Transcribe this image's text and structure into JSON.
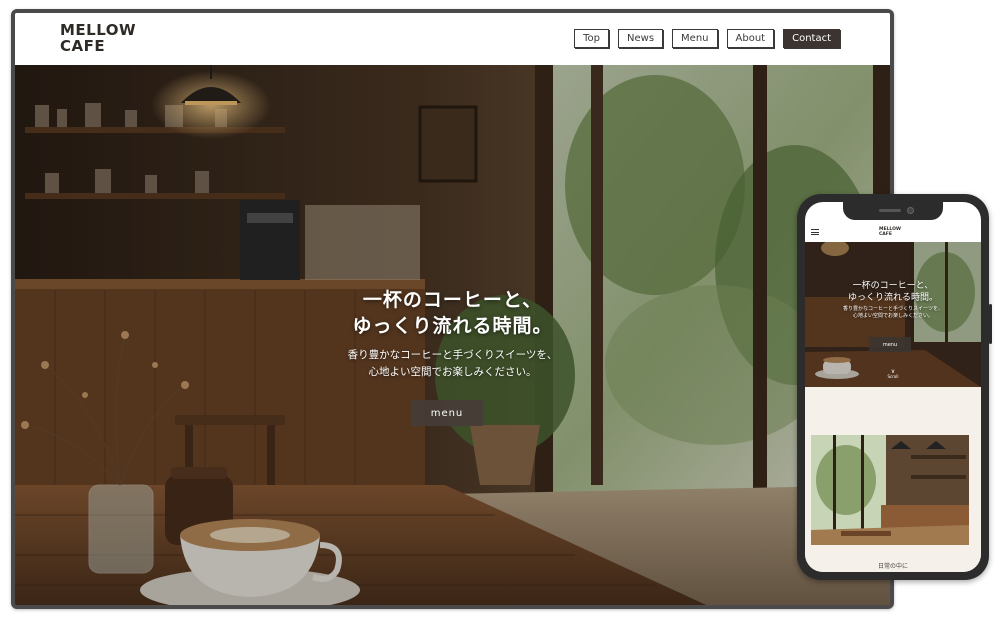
{
  "desktop": {
    "logo": {
      "line1": "MELLOW",
      "line2": "CAFE"
    },
    "nav": [
      {
        "label": "Top"
      },
      {
        "label": "News"
      },
      {
        "label": "Menu"
      },
      {
        "label": "About"
      },
      {
        "label": "Contact"
      }
    ],
    "hero": {
      "title_line1": "一杯のコーヒーと、",
      "title_line2": "ゆっくり流れる時間。",
      "sub_line1": "香り豊かなコーヒーと手づくりスイーツを、",
      "sub_line2": "心地よい空間でお楽しみください。",
      "button_label": "menu"
    }
  },
  "phone": {
    "logo": {
      "line1": "MELLOW",
      "line2": "CAFE"
    },
    "hero": {
      "title_line1": "一杯のコーヒーと、",
      "title_line2": "ゆっくり流れる時間。",
      "sub_line1": "香り豊かなコーヒーと手づくりスイーツを、",
      "sub_line2": "心地よい空間でお楽しみください。",
      "button_label": "menu",
      "scroll_label": "Scroll"
    },
    "section_caption": "日常の中に"
  },
  "colors": {
    "dark_brown": "#3b3430",
    "frame": "#4a4a4a",
    "section_bg": "#f5f0ea"
  }
}
